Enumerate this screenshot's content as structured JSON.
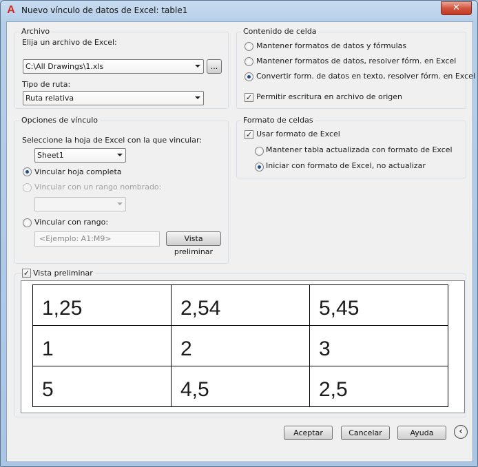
{
  "window": {
    "title": "Nuevo vínculo de datos de Excel: table1",
    "close_glyph": "✕",
    "app_icon_glyph": "A"
  },
  "archivo": {
    "group_title": "Archivo",
    "file_label": "Elija un archivo de Excel:",
    "file_value": "C:\\All Drawings\\1.xls",
    "browse_label": "...",
    "path_type_label": "Tipo de ruta:",
    "path_type_value": "Ruta relativa"
  },
  "contenido": {
    "group_title": "Contenido de celda",
    "options": [
      "Mantener formatos de datos y fórmulas",
      "Mantener formatos de datos, resolver fórm. en Excel",
      "Convertir form. de datos en texto, resolver fórm. en Excel"
    ],
    "selected_index": 2,
    "write_back_label": "Permitir escritura en archivo de origen",
    "write_back_checked": true
  },
  "opciones": {
    "group_title": "Opciones de vínculo",
    "sheet_label": "Seleccione la hoja de Excel con la que vincular:",
    "sheet_value": "Sheet1",
    "link_sheet_label": "Vincular hoja completa",
    "link_named_label": "Vincular con un rango nombrado:",
    "named_value": "",
    "link_range_label": "Vincular con rango:",
    "range_placeholder": "<Ejemplo: A1:M9>",
    "preview_button": "Vista preliminar",
    "selected": "Vincular hoja completa"
  },
  "formato": {
    "group_title": "Formato de celdas",
    "use_excel_label": "Usar formato de Excel",
    "use_excel_checked": true,
    "keep_updated_label": "Mantener tabla actualizada con formato de Excel",
    "start_excel_label": "Iniciar con formato de Excel, no actualizar",
    "selected": "Iniciar con formato de Excel, no actualizar"
  },
  "preview": {
    "checkbox_label": "Vista preliminar",
    "checked": true,
    "rows": [
      [
        "1,25",
        "2,54",
        "5,45"
      ],
      [
        "1",
        "2",
        "3"
      ],
      [
        "5",
        "4,5",
        "2,5"
      ]
    ]
  },
  "footer": {
    "accept": "Aceptar",
    "cancel": "Cancelar",
    "help": "Ayuda",
    "collapse_glyph": "‹"
  }
}
